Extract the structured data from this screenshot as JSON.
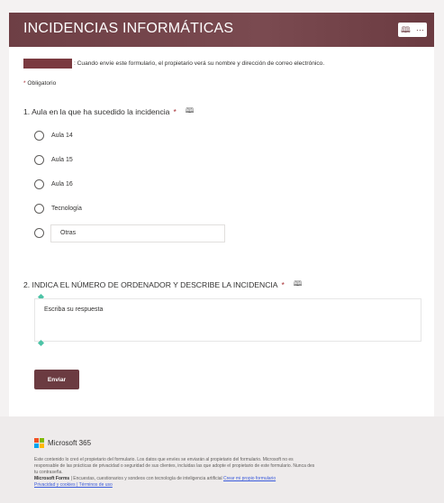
{
  "header": {
    "title": "INCIDENCIAS INFORMÁTICAS",
    "reader_icon": "immersive-reader-icon",
    "more_icon": "more-icon"
  },
  "form": {
    "notice": ": Cuando envíe este formulario, el propietario verá su nombre y dirección de correo electrónico.",
    "required_mark": "*",
    "required_label": "Obligatorio",
    "q1": {
      "label": "1. Aula en la que ha sucedido la incidencia",
      "required_mark": "*",
      "options": [
        "Aula 14",
        "Aula 15",
        "Aula 16",
        "Tecnología"
      ],
      "other_value": "Otras"
    },
    "q2": {
      "label": "2. INDICA EL NÚMERO DE ORDENADOR Y DESCRIBE LA INCIDENCIA",
      "required_mark": "*",
      "placeholder": "Escriba su respuesta"
    },
    "submit_label": "Enviar"
  },
  "footer": {
    "brand": "Microsoft 365",
    "text_line1": "Este contenido lo creó el propietario del formulario. Los datos que envíes se enviarán al propietario del formulario. Microsoft no es",
    "text_line2": "responsable de las prácticas de privacidad o seguridad de sus clientes, incluidas las que adopte el propietario de este formulario. Nunca des",
    "text_line3": "tu contraseña.",
    "forms_bold": "Microsoft Forms",
    "forms_text": "| Encuestas, cuestionarios y sondeos con tecnología de inteligencia artificial",
    "create_link": "Crear mi propio formulario",
    "privacy": "Privacidad y cookies | Términos de uso"
  },
  "colors": {
    "brand": "#6b3b41",
    "required": "#a4262c"
  }
}
